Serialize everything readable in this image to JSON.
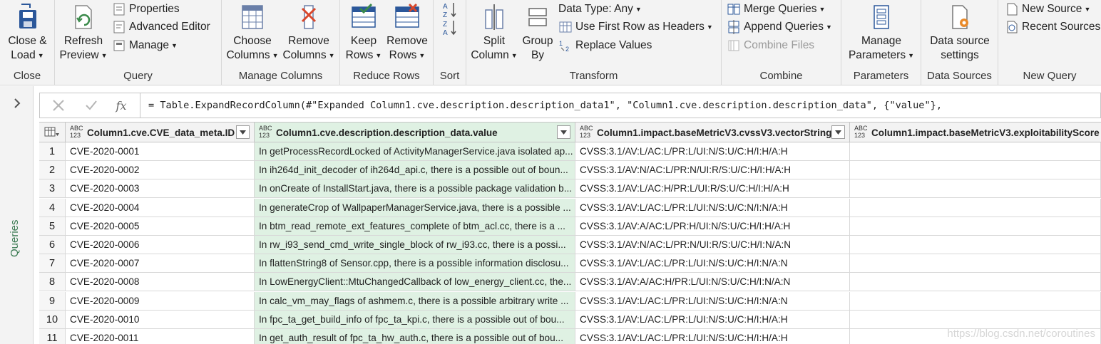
{
  "ribbon": {
    "close_group": {
      "label": "Close",
      "close_load": [
        "Close &",
        "Load"
      ]
    },
    "query_group": {
      "label": "Query",
      "refresh": [
        "Refresh",
        "Preview"
      ],
      "properties": "Properties",
      "advanced_editor": "Advanced Editor",
      "manage": "Manage"
    },
    "manage_columns_group": {
      "label": "Manage Columns",
      "choose": [
        "Choose",
        "Columns"
      ],
      "remove": [
        "Remove",
        "Columns"
      ]
    },
    "reduce_rows_group": {
      "label": "Reduce Rows",
      "keep": [
        "Keep",
        "Rows"
      ],
      "remove": [
        "Remove",
        "Rows"
      ]
    },
    "sort_group": {
      "label": "Sort"
    },
    "transform_group": {
      "label": "Transform",
      "split": [
        "Split",
        "Column"
      ],
      "group_by": [
        "Group",
        "By"
      ],
      "data_type": "Data Type: Any",
      "first_row": "Use First Row as Headers",
      "replace": "Replace Values"
    },
    "combine_group": {
      "label": "Combine",
      "merge": "Merge Queries",
      "append": "Append Queries",
      "combine_files": "Combine Files"
    },
    "parameters_group": {
      "label": "Parameters",
      "manage": [
        "Manage",
        "Parameters"
      ]
    },
    "data_sources_group": {
      "label": "Data Sources",
      "settings": [
        "Data source",
        "settings"
      ]
    },
    "new_query_group": {
      "label": "New Query",
      "new_source": "New Source",
      "recent_sources": "Recent Sources"
    }
  },
  "left_pane": {
    "label": "Queries"
  },
  "formula_bar": {
    "fx": "fx",
    "formula": "= Table.ExpandRecordColumn(#\"Expanded Column1.cve.description.description_data1\", \"Column1.cve.description.description_data\", {\"value\"},"
  },
  "table": {
    "type_badge": [
      "ABC",
      "123"
    ],
    "columns": [
      "Column1.cve.CVE_data_meta.ID",
      "Column1.cve.description.description_data.value",
      "Column1.impact.baseMetricV3.cvssV3.vectorString",
      "Column1.impact.baseMetricV3.exploitabilityScore"
    ],
    "rows": [
      {
        "n": "1",
        "id": "CVE-2020-0001",
        "desc": "In getProcessRecordLocked of ActivityManagerService.java isolated ap...",
        "vector": "CVSS:3.1/AV:L/AC:L/PR:L/UI:N/S:U/C:H/I:H/A:H"
      },
      {
        "n": "2",
        "id": "CVE-2020-0002",
        "desc": "In ih264d_init_decoder of ih264d_api.c, there is a possible out of boun...",
        "vector": "CVSS:3.1/AV:N/AC:L/PR:N/UI:R/S:U/C:H/I:H/A:H"
      },
      {
        "n": "3",
        "id": "CVE-2020-0003",
        "desc": "In onCreate of InstallStart.java, there is a possible package validation b...",
        "vector": "CVSS:3.1/AV:L/AC:H/PR:L/UI:R/S:U/C:H/I:H/A:H"
      },
      {
        "n": "4",
        "id": "CVE-2020-0004",
        "desc": "In generateCrop of WallpaperManagerService.java, there is a possible ...",
        "vector": "CVSS:3.1/AV:L/AC:L/PR:L/UI:N/S:U/C:N/I:N/A:H"
      },
      {
        "n": "5",
        "id": "CVE-2020-0005",
        "desc": "In btm_read_remote_ext_features_complete of btm_acl.cc, there is a ...",
        "vector": "CVSS:3.1/AV:A/AC:L/PR:H/UI:N/S:U/C:H/I:H/A:H"
      },
      {
        "n": "6",
        "id": "CVE-2020-0006",
        "desc": "In rw_i93_send_cmd_write_single_block of rw_i93.cc, there is a possi...",
        "vector": "CVSS:3.1/AV:N/AC:L/PR:N/UI:R/S:U/C:H/I:N/A:N"
      },
      {
        "n": "7",
        "id": "CVE-2020-0007",
        "desc": "In flattenString8 of Sensor.cpp, there is a possible information disclosu...",
        "vector": "CVSS:3.1/AV:L/AC:L/PR:L/UI:N/S:U/C:H/I:N/A:N"
      },
      {
        "n": "8",
        "id": "CVE-2020-0008",
        "desc": "In LowEnergyClient::MtuChangedCallback of low_energy_client.cc, the...",
        "vector": "CVSS:3.1/AV:A/AC:H/PR:L/UI:N/S:U/C:H/I:N/A:N"
      },
      {
        "n": "9",
        "id": "CVE-2020-0009",
        "desc": "In calc_vm_may_flags of ashmem.c, there is a possible arbitrary write ...",
        "vector": "CVSS:3.1/AV:L/AC:L/PR:L/UI:N/S:U/C:H/I:N/A:N"
      },
      {
        "n": "10",
        "id": "CVE-2020-0010",
        "desc": "In fpc_ta_get_build_info of fpc_ta_kpi.c, there is a possible out of bou...",
        "vector": "CVSS:3.1/AV:L/AC:L/PR:L/UI:N/S:U/C:H/I:H/A:H"
      },
      {
        "n": "11",
        "id": "CVE-2020-0011",
        "desc": "In get_auth_result of fpc_ta_hw_auth.c, there is a possible out of bou...",
        "vector": "CVSS:3.1/AV:L/AC:L/PR:L/UI:N/S:U/C:H/I:H/A:H"
      }
    ]
  },
  "watermark": "https://blog.csdn.net/coroutines",
  "colors": {
    "selected_column": "#dff1e3",
    "ribbon_bg": "#f3f3f3",
    "accent_green": "#3a7a52",
    "icon_blue": "#2b579a",
    "icon_red": "#d9472b",
    "icon_orange": "#e98a2a"
  }
}
